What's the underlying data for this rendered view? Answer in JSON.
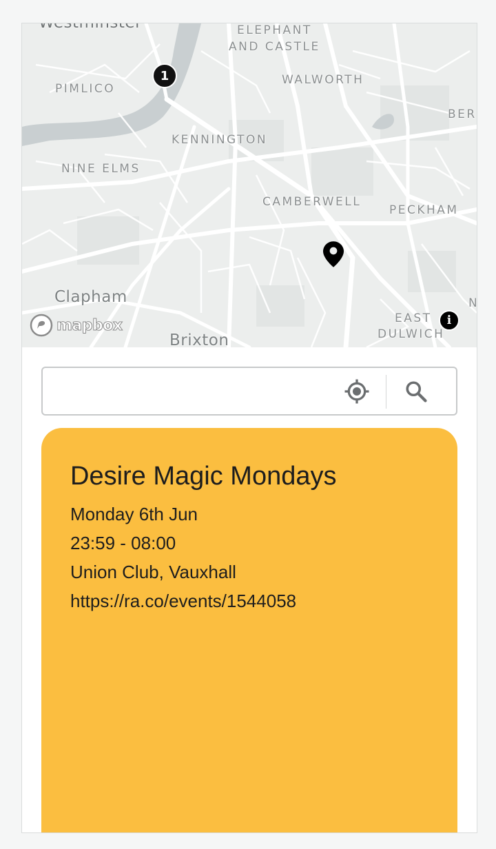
{
  "map": {
    "places": [
      {
        "id": "westminster",
        "label": "Westminster"
      },
      {
        "id": "elephant",
        "label": "ELEPHANT"
      },
      {
        "id": "andcastle",
        "label": "AND CASTLE"
      },
      {
        "id": "pimlico",
        "label": "PIMLICO"
      },
      {
        "id": "walworth",
        "label": "WALWORTH"
      },
      {
        "id": "ber",
        "label": "BER"
      },
      {
        "id": "kennington",
        "label": "KENNINGTON"
      },
      {
        "id": "nineelms",
        "label": "NINE ELMS"
      },
      {
        "id": "camberwell",
        "label": "CAMBERWELL"
      },
      {
        "id": "peckham",
        "label": "PECKHAM"
      },
      {
        "id": "clapham",
        "label": "Clapham"
      },
      {
        "id": "brixton",
        "label": "Brixton"
      },
      {
        "id": "east",
        "label": "EAST"
      },
      {
        "id": "dulwich",
        "label": "DULWICH"
      },
      {
        "id": "n",
        "label": "N"
      }
    ],
    "cluster_count": "1",
    "attribution_logo": "mapbox",
    "info_label": "i",
    "colors": {
      "river": "#c9cfd1",
      "land": "#eceeed",
      "roads": "#ffffff"
    }
  },
  "search": {
    "value": "",
    "placeholder": "",
    "locate_icon": "my-location-icon",
    "search_icon": "search-icon"
  },
  "event": {
    "title": "Desire Magic Mondays",
    "date": "Monday 6th Jun",
    "time": "23:59 - 08:00",
    "venue": "Union Club, Vauxhall",
    "url": "https://ra.co/events/1544058",
    "card_color": "#fbbe40"
  }
}
